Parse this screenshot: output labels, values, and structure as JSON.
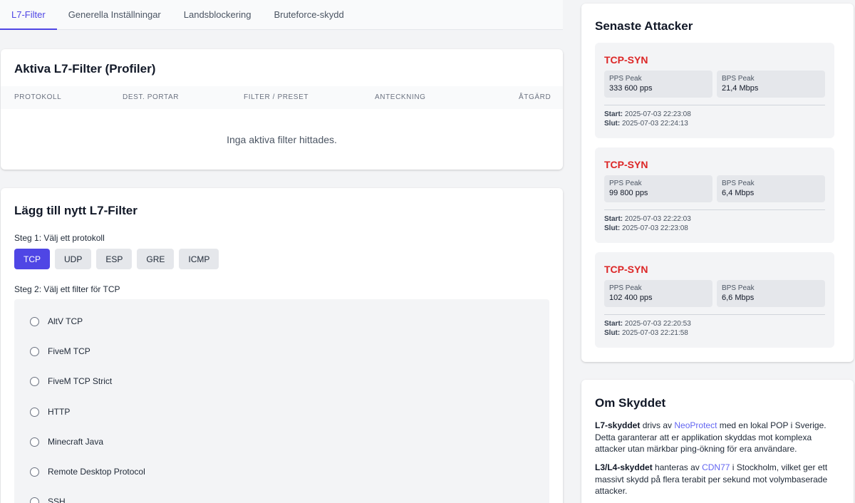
{
  "tabs": [
    {
      "label": "L7-Filter",
      "active": true
    },
    {
      "label": "Generella Inställningar",
      "active": false
    },
    {
      "label": "Landsblockering",
      "active": false
    },
    {
      "label": "Bruteforce-skydd",
      "active": false
    }
  ],
  "active_filters": {
    "title": "Aktiva L7-Filter (Profiler)",
    "columns": [
      "Protokoll",
      "Dest. Portar",
      "Filter / Preset",
      "Anteckning",
      "Åtgärd"
    ],
    "empty_text": "Inga aktiva filter hittades."
  },
  "add_filter": {
    "title": "Lägg till nytt L7-Filter",
    "step1_label": "Steg 1: Välj ett protokoll",
    "protocols": [
      {
        "label": "TCP",
        "selected": true
      },
      {
        "label": "UDP",
        "selected": false
      },
      {
        "label": "ESP",
        "selected": false
      },
      {
        "label": "GRE",
        "selected": false
      },
      {
        "label": "ICMP",
        "selected": false
      }
    ],
    "step2_label": "Steg 2: Välj ett filter för TCP",
    "filters": [
      "AltV TCP",
      "FiveM TCP",
      "FiveM TCP Strict",
      "HTTP",
      "Minecraft Java",
      "Remote Desktop Protocol",
      "SSH"
    ]
  },
  "recent_attacks": {
    "title": "Senaste Attacker",
    "pps_label": "PPS Peak",
    "bps_label": "BPS Peak",
    "start_label": "Start:",
    "end_label": "Slut:",
    "items": [
      {
        "type": "TCP-SYN",
        "pps": "333 600 pps",
        "bps": "21,4 Mbps",
        "start": "2025-07-03 22:23:08",
        "end": "2025-07-03 22:24:13"
      },
      {
        "type": "TCP-SYN",
        "pps": "99 800 pps",
        "bps": "6,4 Mbps",
        "start": "2025-07-03 22:22:03",
        "end": "2025-07-03 22:23:08"
      },
      {
        "type": "TCP-SYN",
        "pps": "102 400 pps",
        "bps": "6,6 Mbps",
        "start": "2025-07-03 22:20:53",
        "end": "2025-07-03 22:21:58"
      }
    ]
  },
  "about": {
    "title": "Om Skyddet",
    "p1_strong": "L7-skyddet",
    "p1_pre": " drivs av ",
    "p1_link": "NeoProtect",
    "p1_post": " med en lokal POP i Sverige. Detta garanterar att er applikation skyddas mot komplexa attacker utan märkbar ping-ökning för era användare.",
    "p2_strong": "L3/L4-skyddet",
    "p2_pre": " hanteras av ",
    "p2_link": "CDN77",
    "p2_post": " i Stockholm, vilket ger ett massivt skydd på flera terabit per sekund mot volymbaserade attacker."
  },
  "colors": {
    "accent": "#4f46e5",
    "attack_red": "#dc2626",
    "link": "#6366f1"
  }
}
